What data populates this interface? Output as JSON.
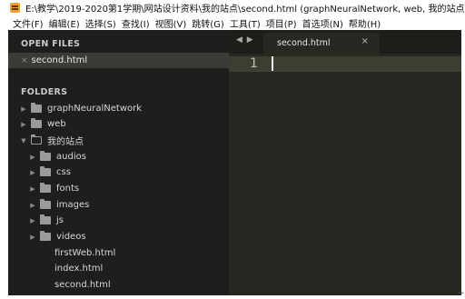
{
  "window": {
    "title": "E:\\教学\\2019-2020第1学期\\网站设计资料\\我的站点\\second.html (graphNeuralNetwork, web, 我的站点) - Subl",
    "app_icon": "sublime-text-icon"
  },
  "menu": [
    "文件(F)",
    "编辑(E)",
    "选择(S)",
    "查找(I)",
    "视图(V)",
    "跳转(G)",
    "工具(T)",
    "项目(P)",
    "首选项(N)",
    "帮助(H)"
  ],
  "sidebar": {
    "open_files_header": "OPEN FILES",
    "open_files": [
      {
        "name": "second.html",
        "active": true,
        "close_glyph": "×"
      }
    ],
    "folders_header": "FOLDERS",
    "tree": [
      {
        "name": "graphNeuralNetwork",
        "type": "folder",
        "expanded": false
      },
      {
        "name": "web",
        "type": "folder",
        "expanded": false
      },
      {
        "name": "我的站点",
        "type": "folder",
        "expanded": true
      },
      {
        "name": "audios",
        "type": "folder",
        "expanded": false
      },
      {
        "name": "css",
        "type": "folder",
        "expanded": false
      },
      {
        "name": "fonts",
        "type": "folder",
        "expanded": false
      },
      {
        "name": "images",
        "type": "folder",
        "expanded": false
      },
      {
        "name": "js",
        "type": "folder",
        "expanded": false
      },
      {
        "name": "videos",
        "type": "folder",
        "expanded": false
      },
      {
        "name": "firstWeb.html",
        "type": "file"
      },
      {
        "name": "index.html",
        "type": "file"
      },
      {
        "name": "second.html",
        "type": "file"
      }
    ]
  },
  "editor": {
    "nav_arrows": "◀ ▶",
    "tabs": [
      {
        "label": "second.html",
        "close_glyph": "×",
        "active": true
      }
    ],
    "line_numbers": [
      "1"
    ]
  },
  "colors": {
    "sidebar_bg": "#1e1f1c",
    "editor_bg": "#272822",
    "selected_row": "#3b3c38",
    "current_line": "#3e3d32",
    "icon_accent": "#f0a030"
  }
}
